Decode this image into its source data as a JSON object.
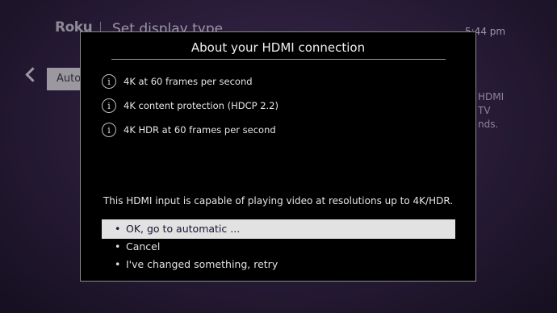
{
  "background": {
    "logo": "Roku",
    "title": "Set display type",
    "time": "5:44 pm",
    "button_label": "Auto",
    "side_text": "HDMI\nTV\nnds."
  },
  "dialog": {
    "title": "About your HDMI connection",
    "features": [
      {
        "icon": "info-icon",
        "label": "4K at 60 frames per second"
      },
      {
        "icon": "info-icon",
        "label": "4K content protection (HDCP 2.2)"
      },
      {
        "icon": "info-icon",
        "label": "4K HDR at 60 frames per second"
      }
    ],
    "description": "This HDMI input is capable of playing video at resolutions up to 4K/HDR.",
    "options": [
      {
        "label": "OK, go to automatic ...",
        "selected": true
      },
      {
        "label": "Cancel",
        "selected": false
      },
      {
        "label": "I've changed something, retry",
        "selected": false
      }
    ],
    "bullet": "•"
  },
  "colors": {
    "dialog_background": "#000000",
    "selected_option_background": "#e2e2e2",
    "screen_background": "#2a1d3a"
  }
}
